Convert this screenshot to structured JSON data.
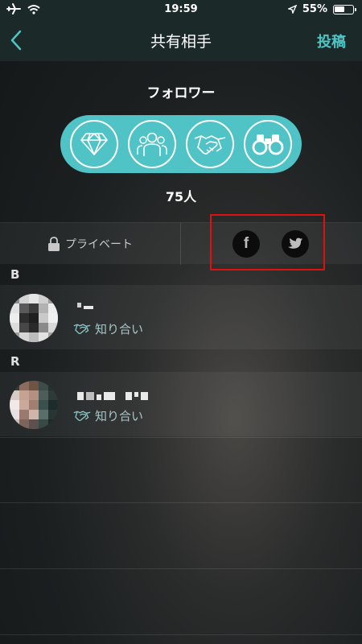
{
  "status_bar": {
    "time": "19:59",
    "battery_pct": "55%",
    "battery_level": 0.55
  },
  "nav": {
    "title": "共有相手",
    "post_label": "投稿"
  },
  "audience": {
    "title": "フォロワー",
    "categories": [
      {
        "icon": "diamond-icon"
      },
      {
        "icon": "group-icon"
      },
      {
        "icon": "handshake-icon"
      },
      {
        "icon": "binoculars-icon"
      }
    ],
    "count": "75人"
  },
  "filter": {
    "private_label": "プライベート",
    "share_targets": [
      {
        "icon": "facebook-icon",
        "glyph": "f"
      },
      {
        "icon": "twitter-icon"
      }
    ]
  },
  "groups": [
    {
      "letter": "B",
      "contacts": [
        {
          "relation": "知り合い"
        }
      ]
    },
    {
      "letter": "R",
      "contacts": [
        {
          "relation": "知り合い"
        }
      ]
    }
  ],
  "colors": {
    "accent": "#50c3c6",
    "post": "#4fc4c4",
    "highlight": "#e01010"
  }
}
